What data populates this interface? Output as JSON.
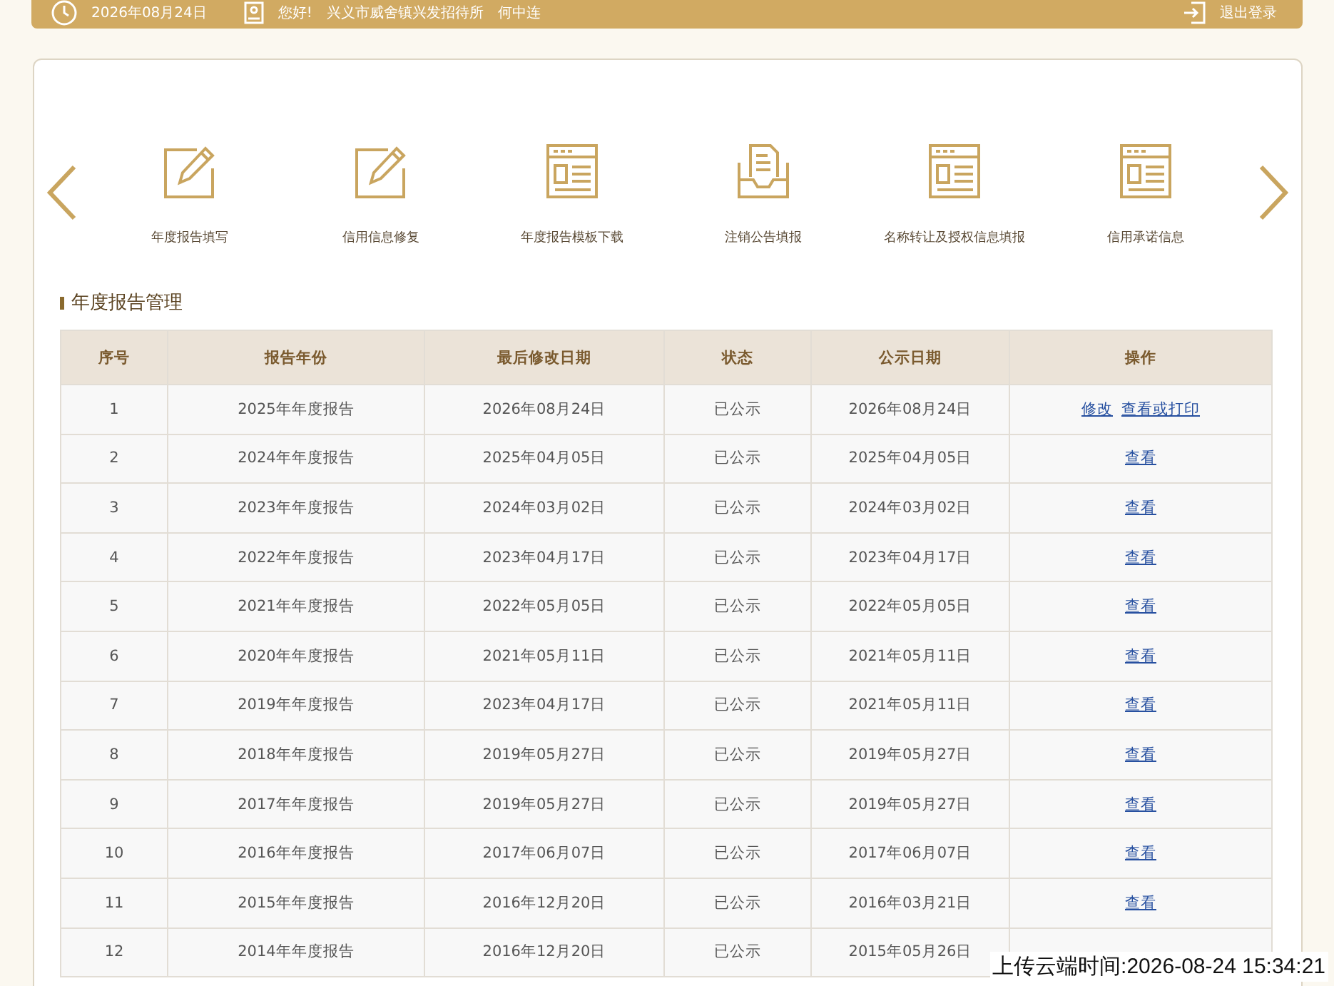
{
  "top_bar": {
    "date": "2026年08月24日",
    "greeting": "您好!",
    "org": "兴义市威舍镇兴发招待所",
    "user": "何中连",
    "logout": "退出登录"
  },
  "shortcuts": [
    {
      "kind": "edit",
      "label": "年度报告填写"
    },
    {
      "kind": "edit",
      "label": "信用信息修复"
    },
    {
      "kind": "form",
      "label": "年度报告模板下载"
    },
    {
      "kind": "inbox",
      "label": "注销公告填报"
    },
    {
      "kind": "form",
      "label": "名称转让及授权信息填报"
    },
    {
      "kind": "form",
      "label": "信用承诺信息"
    }
  ],
  "section_title": "年度报告管理",
  "table": {
    "columns": [
      "序号",
      "报告年份",
      "最后修改日期",
      "状态",
      "公示日期",
      "操作"
    ],
    "rows": [
      {
        "cells": [
          "1",
          "2025年年度报告",
          "2026年08月24日",
          "已公示",
          "2026年08月24日"
        ],
        "actions": [
          "修改",
          "查看或打印"
        ]
      },
      {
        "cells": [
          "2",
          "2024年年度报告",
          "2025年04月05日",
          "已公示",
          "2025年04月05日"
        ],
        "actions": [
          "查看"
        ]
      },
      {
        "cells": [
          "3",
          "2023年年度报告",
          "2024年03月02日",
          "已公示",
          "2024年03月02日"
        ],
        "actions": [
          "查看"
        ]
      },
      {
        "cells": [
          "4",
          "2022年年度报告",
          "2023年04月17日",
          "已公示",
          "2023年04月17日"
        ],
        "actions": [
          "查看"
        ]
      },
      {
        "cells": [
          "5",
          "2021年年度报告",
          "2022年05月05日",
          "已公示",
          "2022年05月05日"
        ],
        "actions": [
          "查看"
        ]
      },
      {
        "cells": [
          "6",
          "2020年年度报告",
          "2021年05月11日",
          "已公示",
          "2021年05月11日"
        ],
        "actions": [
          "查看"
        ]
      },
      {
        "cells": [
          "7",
          "2019年年度报告",
          "2023年04月17日",
          "已公示",
          "2021年05月11日"
        ],
        "actions": [
          "查看"
        ]
      },
      {
        "cells": [
          "8",
          "2018年年度报告",
          "2019年05月27日",
          "已公示",
          "2019年05月27日"
        ],
        "actions": [
          "查看"
        ]
      },
      {
        "cells": [
          "9",
          "2017年年度报告",
          "2019年05月27日",
          "已公示",
          "2019年05月27日"
        ],
        "actions": [
          "查看"
        ]
      },
      {
        "cells": [
          "10",
          "2016年年度报告",
          "2017年06月07日",
          "已公示",
          "2017年06月07日"
        ],
        "actions": [
          "查看"
        ]
      },
      {
        "cells": [
          "11",
          "2015年年度报告",
          "2016年12月20日",
          "已公示",
          "2016年03月21日"
        ],
        "actions": [
          "查看"
        ]
      },
      {
        "cells": [
          "12",
          "2014年年度报告",
          "2016年12月20日",
          "已公示",
          "2015年05月26日"
        ]
      }
    ]
  },
  "upload_stamp": "上传云端时间:2026-08-24 15:34:21"
}
